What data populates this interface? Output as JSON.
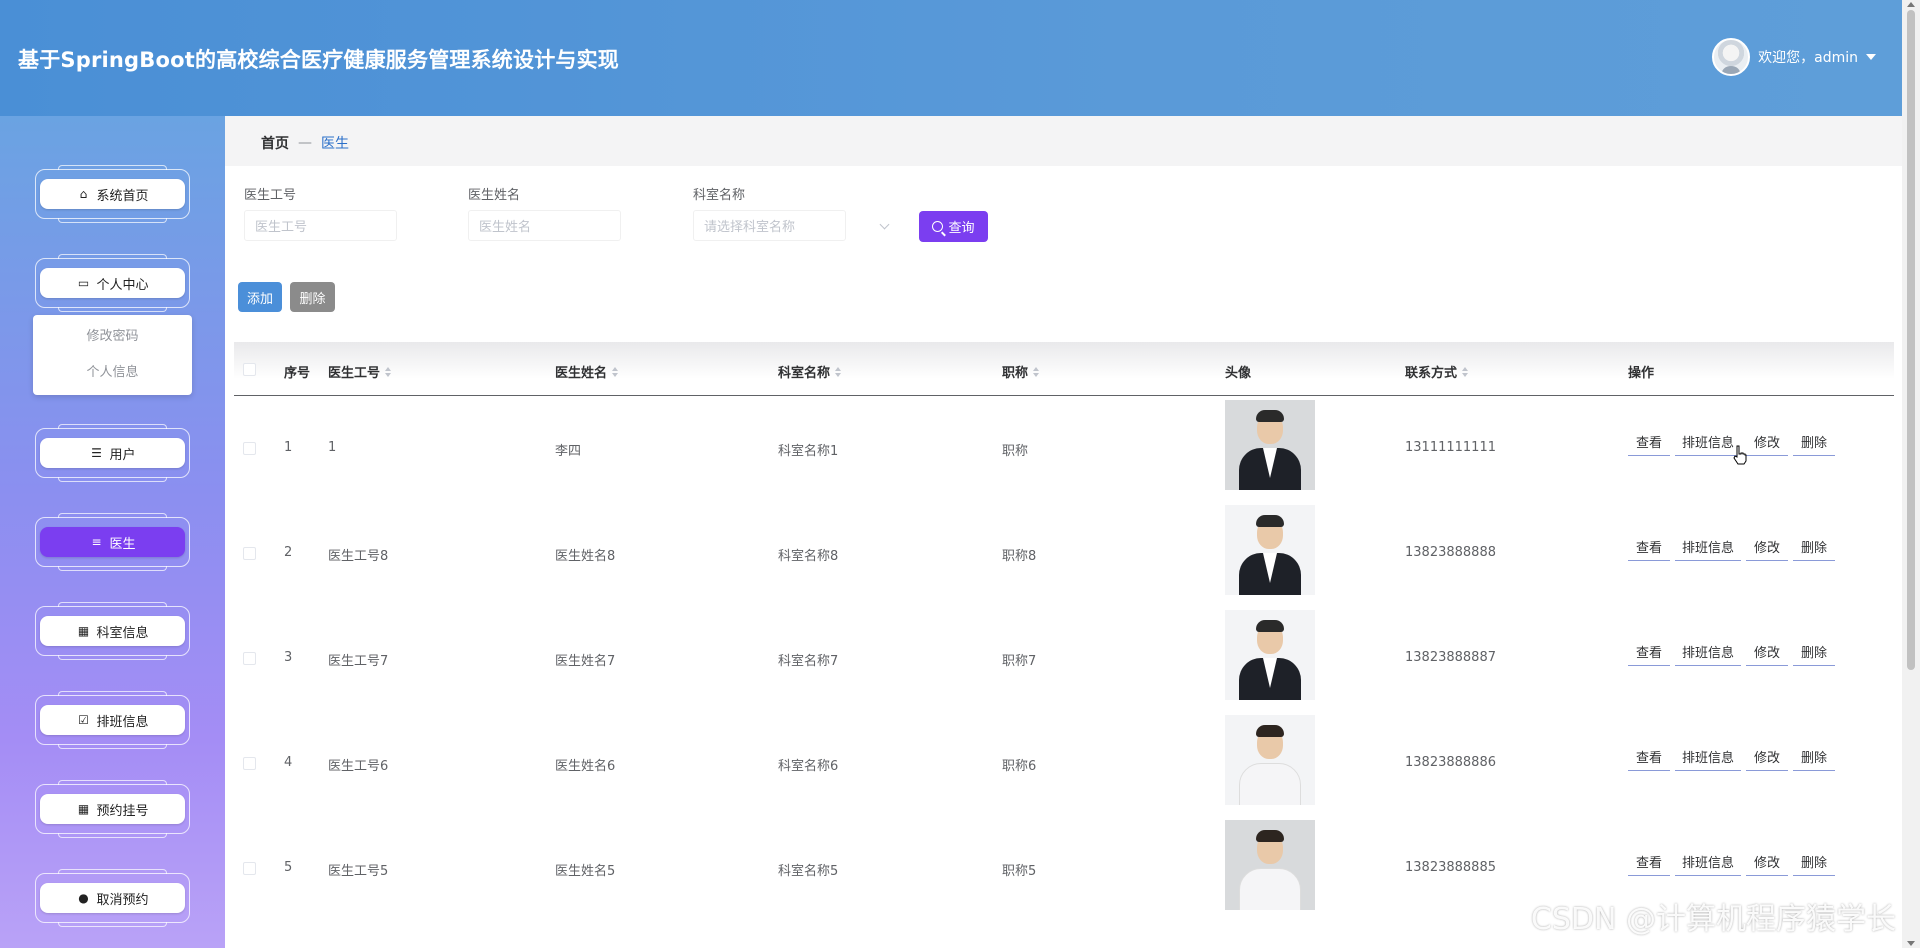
{
  "header": {
    "title": "基于SpringBoot的高校综合医疗健康服务管理系统设计与实现",
    "welcome": "欢迎您，admin"
  },
  "sidebar": {
    "items": [
      {
        "label": "系统首页",
        "icon": "home-icon"
      },
      {
        "label": "个人中心",
        "icon": "wallet-icon"
      },
      {
        "label": "用户",
        "icon": "sliders-icon"
      },
      {
        "label": "医生",
        "icon": "list-icon",
        "active": true
      },
      {
        "label": "科室信息",
        "icon": "grid-icon"
      },
      {
        "label": "排班信息",
        "icon": "clipboard-check-icon"
      },
      {
        "label": "预约挂号",
        "icon": "grid-icon"
      },
      {
        "label": "取消预约",
        "icon": "bulb-icon"
      }
    ],
    "submenu": [
      "修改密码",
      "个人信息"
    ]
  },
  "breadcrumb": {
    "home": "首页",
    "separator": "—",
    "current": "医生"
  },
  "search": {
    "fields": [
      {
        "label": "医生工号",
        "placeholder": "医生工号"
      },
      {
        "label": "医生姓名",
        "placeholder": "医生姓名"
      },
      {
        "label": "科室名称",
        "placeholder": "请选择科室名称"
      }
    ],
    "query_label": "查询"
  },
  "actions": {
    "add": "添加",
    "delete": "删除"
  },
  "table": {
    "columns": [
      "序号",
      "医生工号",
      "医生姓名",
      "科室名称",
      "职称",
      "头像",
      "联系方式",
      "操作"
    ],
    "rows": [
      {
        "index": "1",
        "doctor_id": "1",
        "doctor_name": "李四",
        "department": "科室名称1",
        "title": "职称",
        "phone": "13111111111",
        "photo": "doctor-male-suit"
      },
      {
        "index": "2",
        "doctor_id": "医生工号8",
        "doctor_name": "医生姓名8",
        "department": "科室名称8",
        "title": "职称8",
        "phone": "13823888888",
        "photo": "doctor-male-suit"
      },
      {
        "index": "3",
        "doctor_id": "医生工号7",
        "doctor_name": "医生姓名7",
        "department": "科室名称7",
        "title": "职称7",
        "phone": "13823888887",
        "photo": "doctor-male-suit"
      },
      {
        "index": "4",
        "doctor_id": "医生工号6",
        "doctor_name": "医生姓名6",
        "department": "科室名称6",
        "title": "职称6",
        "phone": "13823888886",
        "photo": "doctor-female-white-coat"
      },
      {
        "index": "5",
        "doctor_id": "医生工号5",
        "doctor_name": "医生姓名5",
        "department": "科室名称5",
        "title": "职称5",
        "phone": "13823888885",
        "photo": "doctor-male-white-coat"
      }
    ],
    "row_actions": [
      "查看",
      "排班信息",
      "修改",
      "删除"
    ]
  },
  "watermark": "CSDN @计算机程序猿学长",
  "colors": {
    "accent": "#7b3ef0",
    "header": "#5a9ad8",
    "add": "#4b8fd9",
    "delete": "#8b8b8b"
  }
}
